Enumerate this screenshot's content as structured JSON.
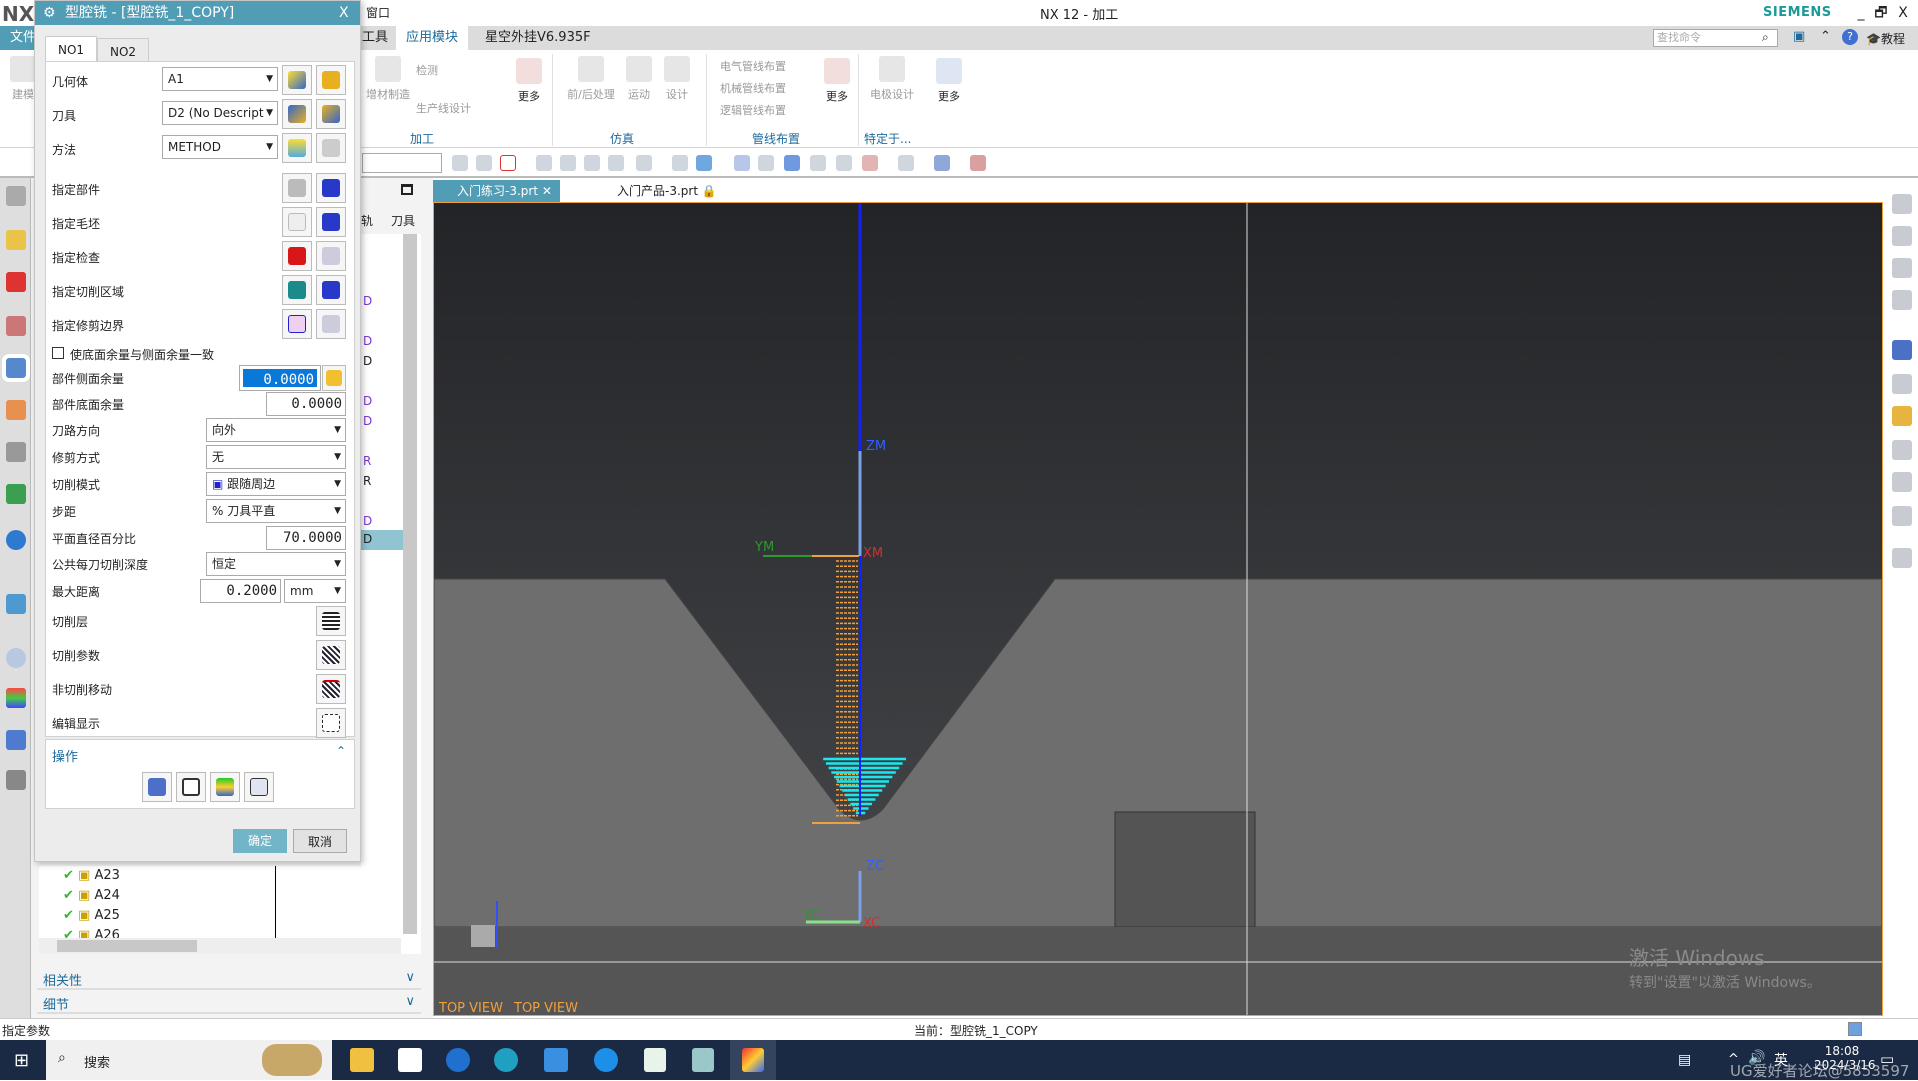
{
  "window": {
    "title": "NX 12 - 加工",
    "brand": "SIEMENS",
    "logo": "NX",
    "menu_partial": "窗口",
    "minimize": "_",
    "restore": "🗗",
    "close": "X"
  },
  "menubar": {
    "tabs": [
      "文件",
      "工具",
      "应用模块",
      "星空外挂V6.935F"
    ],
    "active": "应用模块",
    "search_placeholder": "查找命令",
    "tutorial": "教程"
  },
  "ribbon": {
    "groups": [
      {
        "name": "加工",
        "items": [
          "增材制造",
          "检测",
          "生产线设计",
          "更多"
        ]
      },
      {
        "name": "仿真",
        "items": [
          "前/后处理",
          "运动",
          "设计"
        ]
      },
      {
        "name": "管线布置",
        "items": [
          "电气管线布置",
          "机械管线布置",
          "逻辑管线布置",
          "更多"
        ]
      },
      {
        "name": "特定于...",
        "items": [
          "电极设计",
          "更多"
        ]
      }
    ],
    "left_partial": "建模"
  },
  "doc_tabs": [
    {
      "label": "入门练习-3.prt",
      "active": true
    },
    {
      "label": "入门产品-3.prt",
      "active": false
    }
  ],
  "navigator": {
    "col_partial": "轨",
    "col_tool": "刀具",
    "tool_cells": [
      "D",
      "D",
      "D",
      "D",
      "D",
      "R",
      "R",
      "D",
      "D"
    ],
    "tree_items": [
      {
        "name": "A23",
        "status": "complete"
      },
      {
        "name": "A24",
        "status": "complete"
      },
      {
        "name": "A25",
        "status": "complete"
      },
      {
        "name": "A26",
        "status": "complete"
      }
    ],
    "sections": [
      "相关性",
      "细节"
    ]
  },
  "viewport": {
    "view_labels": [
      "TOP VIEW",
      "TOP VIEW"
    ],
    "axis_labels": {
      "zm": "ZM",
      "xm": "XM",
      "ym": "YM",
      "zc": "ZC",
      "xc": "XC",
      "yc": "YC"
    },
    "watermark_line1": "激活 Windows",
    "watermark_line2": "转到\"设置\"以激活 Windows。",
    "bg_top": "#232427",
    "part_color": "#6e6e6e",
    "toolpath_color": "#f0a040",
    "cut_color": "#19e8f0"
  },
  "dialog": {
    "title": "型腔铣 - [型腔铣_1_COPY]",
    "close": "X",
    "tabs": [
      "NO1",
      "NO2"
    ],
    "active_tab": "NO1",
    "geometry": {
      "label": "几何体",
      "value": "A1"
    },
    "tool": {
      "label": "刀具",
      "value": "D2 (No Descript"
    },
    "method": {
      "label": "方法",
      "value": "METHOD"
    },
    "specify": [
      "指定部件",
      "指定毛坯",
      "指定检查",
      "指定切削区域",
      "指定修剪边界"
    ],
    "checkbox": {
      "label": "使底面余量与侧面余量一致",
      "checked": false
    },
    "part_side_stock": {
      "label": "部件侧面余量",
      "value": "0.0000"
    },
    "part_floor_stock": {
      "label": "部件底面余量",
      "value": "0.0000"
    },
    "path_direction": {
      "label": "刀路方向",
      "value": "向外"
    },
    "trim_method": {
      "label": "修剪方式",
      "value": "无"
    },
    "cut_pattern": {
      "label": "切削模式",
      "value": "跟随周边"
    },
    "stepover": {
      "label": "步距",
      "value": "% 刀具平直"
    },
    "flat_diameter_pct": {
      "label": "平面直径百分比",
      "value": "70.0000"
    },
    "depth_per_cut": {
      "label": "公共每刀切削深度",
      "value": "恒定"
    },
    "max_distance": {
      "label": "最大距离",
      "value": "0.2000",
      "unit": "mm"
    },
    "buttons_rows": [
      "切削层",
      "切削参数",
      "非切削移动",
      "编辑显示"
    ],
    "actions_label": "操作",
    "ok": "确定",
    "cancel": "取消"
  },
  "status": {
    "prompt": "指定参数",
    "current": "当前：型腔铣_1_COPY"
  },
  "taskbar": {
    "search": "搜索",
    "ime": "英",
    "time": "18:08",
    "date": "2024/3/16",
    "overlay_text": "UG爱好者论坛@5853597"
  }
}
